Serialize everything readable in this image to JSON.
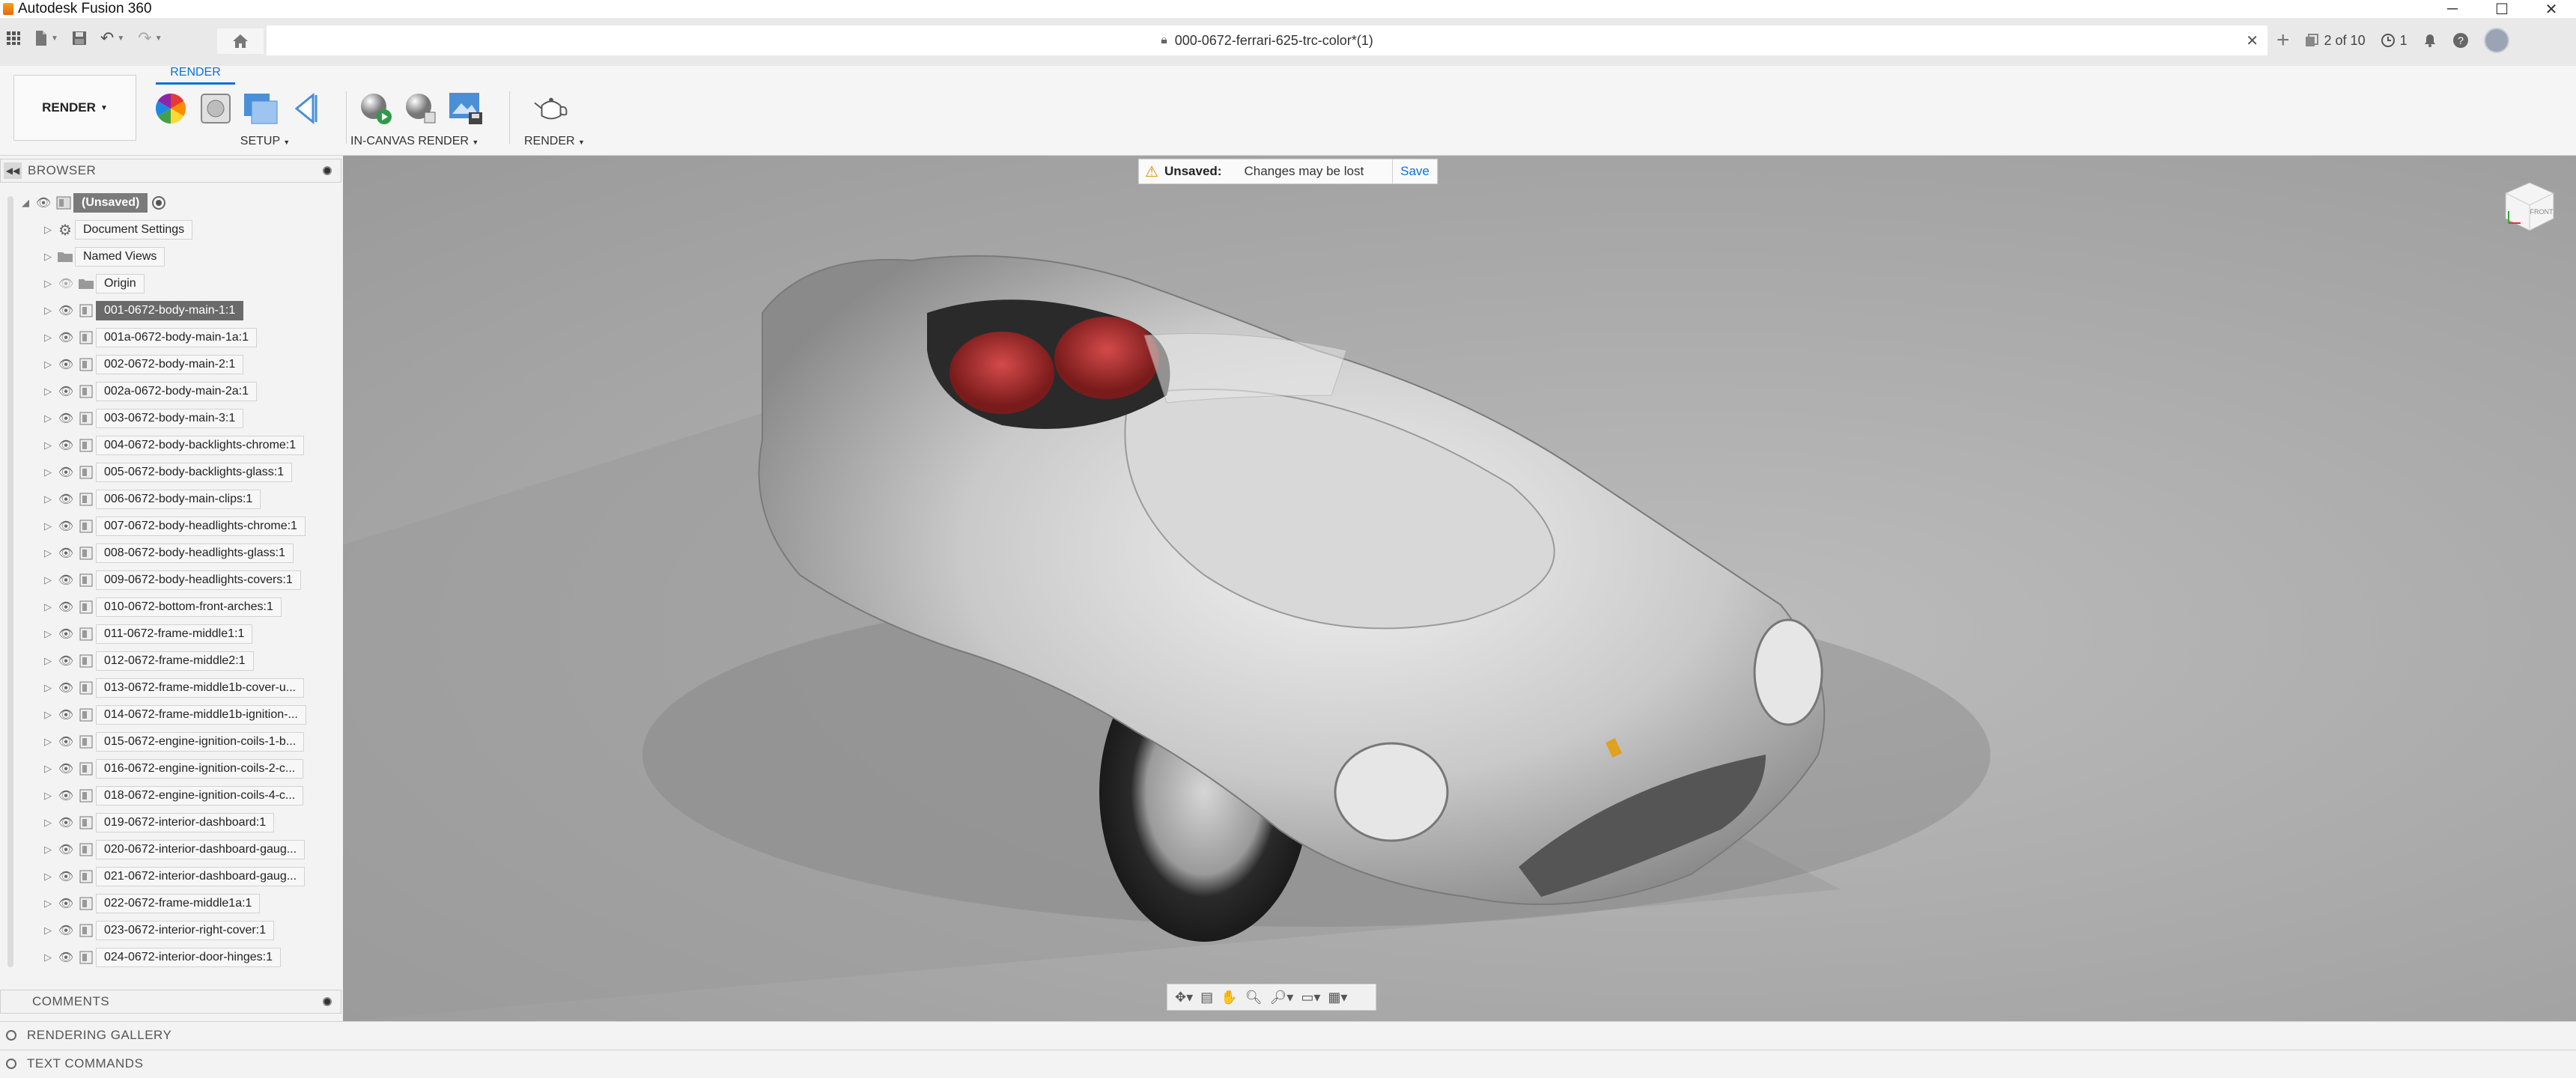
{
  "window": {
    "title": "Autodesk Fusion 360",
    "controls": [
      "─",
      "☐",
      "✕"
    ]
  },
  "quick_access": {
    "doc_title": "000-0672-ferrari-625-trc-color*(1)",
    "close_glyph": "✕",
    "new_tab_glyph": "+",
    "version": "2 of 10",
    "jobs_count": "1"
  },
  "ribbon": {
    "workspace": "RENDER",
    "tab": "RENDER",
    "groups": {
      "setup": "SETUP",
      "in_canvas": "IN-CANVAS RENDER",
      "render": "RENDER"
    }
  },
  "browser": {
    "header": "BROWSER",
    "root_label": "(Unsaved)",
    "folders": [
      "Document Settings",
      "Named Views",
      "Origin"
    ],
    "components": [
      "001-0672-body-main-1:1",
      "001a-0672-body-main-1a:1",
      "002-0672-body-main-2:1",
      "002a-0672-body-main-2a:1",
      "003-0672-body-main-3:1",
      "004-0672-body-backlights-chrome:1",
      "005-0672-body-backlights-glass:1",
      "006-0672-body-main-clips:1",
      "007-0672-body-headlights-chrome:1",
      "008-0672-body-headlights-glass:1",
      "009-0672-body-headlights-covers:1",
      "010-0672-bottom-front-arches:1",
      "011-0672-frame-middle1:1",
      "012-0672-frame-middle2:1",
      "013-0672-frame-middle1b-cover-u...",
      "014-0672-frame-middle1b-ignition-...",
      "015-0672-engine-ignition-coils-1-b...",
      "016-0672-engine-ignition-coils-2-c...",
      "018-0672-engine-ignition-coils-4-c...",
      "019-0672-interior-dashboard:1",
      "020-0672-interior-dashboard-gaug...",
      "021-0672-interior-dashboard-gaug...",
      "022-0672-frame-middle1a:1",
      "023-0672-interior-right-cover:1",
      "024-0672-interior-door-hinges:1"
    ]
  },
  "banner": {
    "label": "Unsaved:",
    "message": "Changes may be lost",
    "save": "Save"
  },
  "viewcube": {
    "face": "FRONT"
  },
  "comments": {
    "header": "COMMENTS"
  },
  "bottom": {
    "gallery": "RENDERING GALLERY",
    "text_commands": "TEXT COMMANDS"
  }
}
